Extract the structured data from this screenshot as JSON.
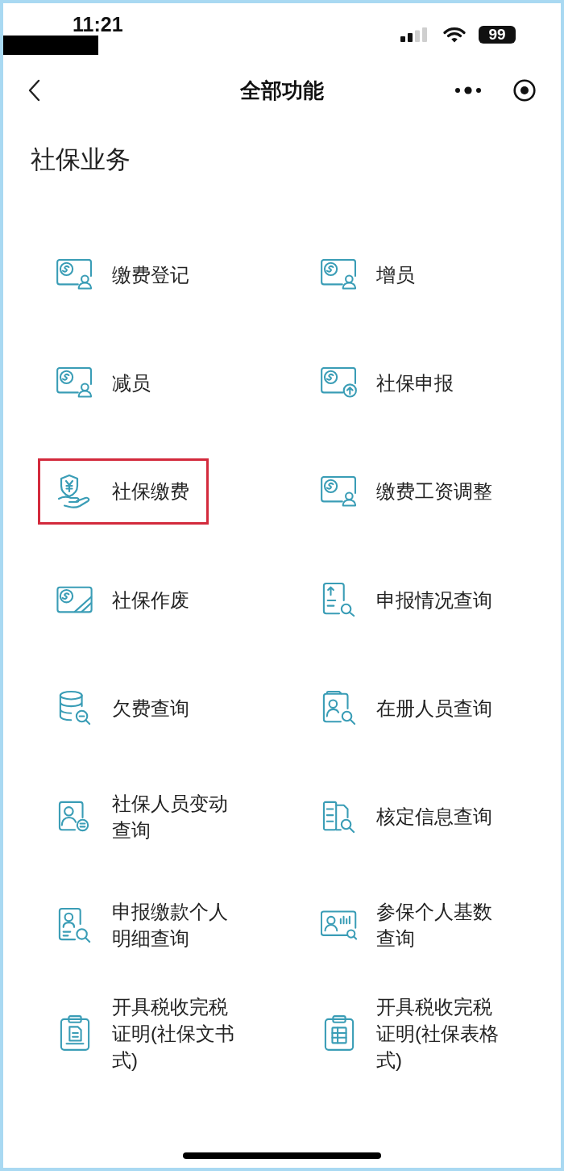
{
  "status_bar": {
    "time": "11:21",
    "battery": "99"
  },
  "nav_bar": {
    "title": "全部功能"
  },
  "section": {
    "title": "社保业务",
    "items": [
      {
        "label": "缴费登记",
        "highlighted": false
      },
      {
        "label": "增员",
        "highlighted": false
      },
      {
        "label": "减员",
        "highlighted": false
      },
      {
        "label": "社保申报",
        "highlighted": false
      },
      {
        "label": "社保缴费",
        "highlighted": true
      },
      {
        "label": "缴费工资调整",
        "highlighted": false
      },
      {
        "label": "社保作废",
        "highlighted": false
      },
      {
        "label": "申报情况查询",
        "highlighted": false
      },
      {
        "label": "欠费查询",
        "highlighted": false
      },
      {
        "label": "在册人员查询",
        "highlighted": false
      },
      {
        "label": "社保人员变动查询",
        "highlighted": false
      },
      {
        "label": "核定信息查询",
        "highlighted": false
      },
      {
        "label": "申报缴款个人明细查询",
        "highlighted": false
      },
      {
        "label": "参保个人基数查询",
        "highlighted": false
      },
      {
        "label": "开具税收完税证明(社保文书式)",
        "highlighted": false
      },
      {
        "label": "开具税收完税证明(社保表格式)",
        "highlighted": false
      }
    ]
  }
}
